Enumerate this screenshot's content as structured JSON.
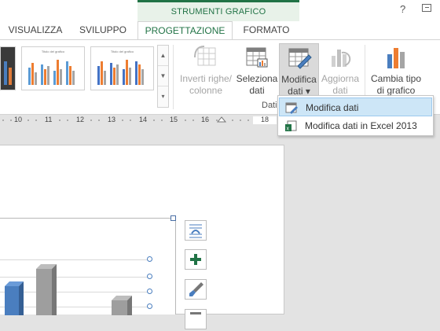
{
  "contextual": {
    "header": "STRUMENTI GRAFICO"
  },
  "window": {
    "help": "?"
  },
  "tabs": [
    {
      "label": "VISUALIZZA"
    },
    {
      "label": "SVILUPPO"
    },
    {
      "label": "PROGETTAZIONE",
      "active": true
    },
    {
      "label": "FORMATO"
    }
  ],
  "ribbon": {
    "gallery_thumb_title": "Titolo del grafico",
    "buttons": {
      "inverti": {
        "line1": "Inverti righe/",
        "line2": "colonne",
        "disabled": true
      },
      "seleziona": {
        "line1": "Seleziona",
        "line2": "dati"
      },
      "modifica": {
        "line1": "Modifica",
        "line2": "dati ▾"
      },
      "aggiorna": {
        "line1": "Aggiorna",
        "line2": "dati",
        "disabled": true
      },
      "cambia": {
        "line1": "Cambia tipo",
        "line2": "di grafico"
      }
    },
    "group_label": "Dati"
  },
  "ruler": {
    "ticks": [
      "10",
      "11",
      "12",
      "13",
      "14",
      "15",
      "16",
      "18"
    ]
  },
  "menu": {
    "items": [
      {
        "label": "Modifica dati",
        "highlighted": true
      },
      {
        "label": "Modifica dati in Excel 2013"
      }
    ]
  },
  "colors": {
    "accent": "#217346",
    "highlight": "#cde6f7",
    "bar_blue": "#4a7ebf",
    "bar_gray": "#9e9e9e"
  }
}
